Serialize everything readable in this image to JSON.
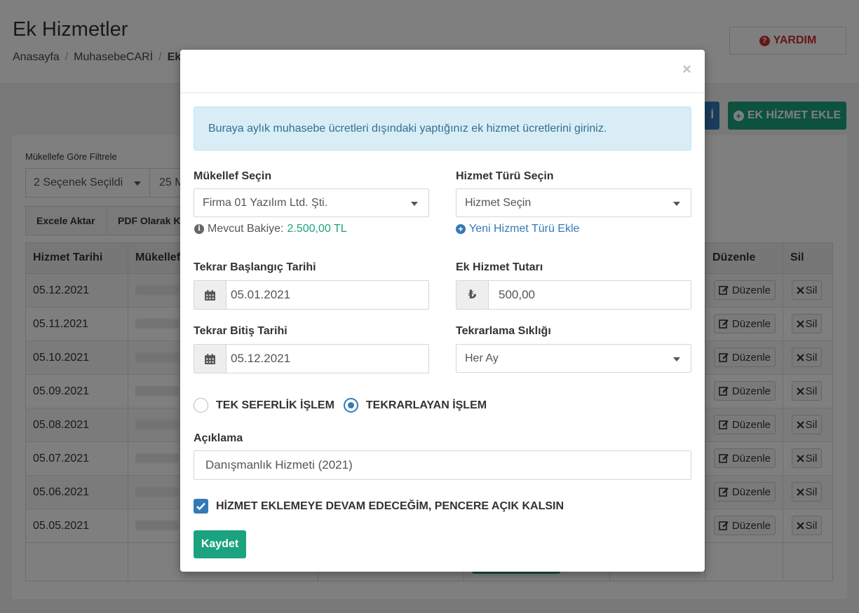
{
  "page": {
    "title": "Ek Hizmetler",
    "breadcrumb": [
      "Anasayfa",
      "MuhasebeCARİ",
      "Ek"
    ],
    "help_button": "YARDIM",
    "blue_button_partial": "İ",
    "add_button": "EK HİZMET EKLE"
  },
  "filter": {
    "label": "Mükellefe Göre Filtrele",
    "selected": "2 Seçenek Seçildi",
    "page_size_partial": "25 M"
  },
  "toolbar": {
    "excel": "Excele Aktar",
    "pdf": "PDF Olarak K"
  },
  "table": {
    "headers": {
      "date": "Hizmet Tarihi",
      "mukellef": "Mükellef",
      "edit": "Düzenle",
      "delete": "Sil"
    },
    "edit_label": "Düzenle",
    "delete_label": "Sil",
    "rows": [
      {
        "date": "05.12.2021"
      },
      {
        "date": "05.11.2021"
      },
      {
        "date": "05.10.2021"
      },
      {
        "date": "05.09.2021"
      },
      {
        "date": "05.08.2021"
      },
      {
        "date": "05.07.2021"
      },
      {
        "date": "05.06.2021"
      },
      {
        "date": "05.05.2021"
      }
    ]
  },
  "modal": {
    "close": "×",
    "alert": "Buraya aylık muhasebe ücretleri dışındaki yaptığınız ek hizmet ücretlerini giriniz.",
    "mukellef_label": "Mükellef Seçin",
    "mukellef_value": "Firma 01 Yazılım Ltd. Şti.",
    "balance_label": "Mevcut Bakiye:",
    "balance_value": "2.500,00 TL",
    "service_type_label": "Hizmet Türü Seçin",
    "service_type_value": "Hizmet Seçin",
    "new_service_link": "Yeni Hizmet Türü Ekle",
    "start_date_label": "Tekrar Başlangıç Tarihi",
    "start_date_value": "05.01.2021",
    "amount_label": "Ek Hizmet Tutarı",
    "amount_currency": "₺",
    "amount_value": "500,00",
    "end_date_label": "Tekrar Bitiş Tarihi",
    "end_date_value": "05.12.2021",
    "frequency_label": "Tekrarlama Sıklığı",
    "frequency_value": "Her Ay",
    "radio_single": "TEK SEFERLİK İŞLEM",
    "radio_recurring": "TEKRARLAYAN İŞLEM",
    "radio_selected": "recurring",
    "description_label": "Açıklama",
    "description_value": "Danışmanlık Hizmeti (2021)",
    "keep_open_label": "HİZMET EKLEMEYE DEVAM EDECEĞİM, PENCERE AÇIK KALSIN",
    "keep_open_checked": true,
    "save_button": "Kaydet"
  },
  "colors": {
    "primary": "#337ab7",
    "success": "#1ba37f",
    "danger": "#c9302c",
    "alert_bg": "#d9edf7",
    "alert_text": "#31708f"
  },
  "icons": [
    "question-circle-icon",
    "plus-circle-icon",
    "info-circle-icon",
    "calendar-icon",
    "lira-icon",
    "edit-icon",
    "times-icon",
    "close-icon",
    "check-icon"
  ]
}
